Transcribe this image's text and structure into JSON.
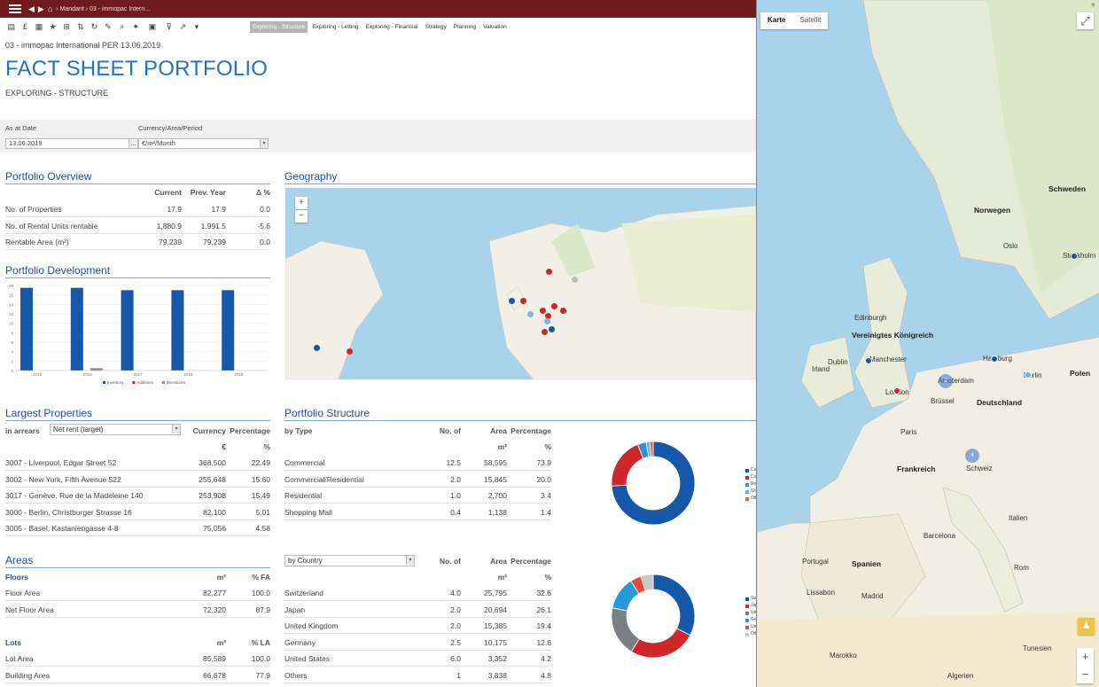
{
  "topbar": {
    "breadcrumb": "› Mandant › 03 - immopac Intern..."
  },
  "toolbar": {
    "tabs": [
      "Exploring - Structure",
      "Exploring - Letting",
      "Exploring - Financial",
      "Strategy",
      "Planning",
      "Valuation"
    ],
    "active_tab": "Exploring - Structure"
  },
  "header": {
    "subtitle": "03 - immopac International PER 13.06.2019",
    "title": "FACT SHEET PORTFOLIO",
    "section": "EXPLORING - STRUCTURE"
  },
  "params": {
    "as_at_label": "As at Date",
    "as_at_value": "13.06.2019",
    "currency_label": "Currency/Area/Period",
    "currency_value": "€/m²/Month",
    "date_button": "..."
  },
  "overview": {
    "title": "Portfolio Overview",
    "headers": [
      "Current",
      "Prev. Year",
      "Δ %"
    ],
    "rows": [
      {
        "label": "No. of Properties",
        "current": "17.9",
        "prev": "17.9",
        "delta": "0.0"
      },
      {
        "label": "No. of Rental Units rentable",
        "current": "1,880.9",
        "prev": "1,991.5",
        "delta": "-5.6"
      },
      {
        "label": "Rentable Area (m²)",
        "current": "79,239",
        "prev": "79,239",
        "delta": "0.0"
      }
    ]
  },
  "development": {
    "title": "Portfolio Development"
  },
  "geography": {
    "title": "Geography",
    "zoom_in": "+",
    "zoom_out": "−"
  },
  "largest": {
    "title": "Largest Properties",
    "in_arrears": "in arrears",
    "dropdown": "Net rent (target)",
    "col_currency": "Currency",
    "col_percentage": "Percentage",
    "unit_currency": "€",
    "unit_pct": "%",
    "rows": [
      {
        "name": "3007 - Liverpool, Edgar Street 52",
        "value": "368,500",
        "pct": "22.49"
      },
      {
        "name": "3002 - New York, Fifth Avenue 522",
        "value": "255,648",
        "pct": "15.60"
      },
      {
        "name": "3017 - Genève, Rue de la Madeleine 140",
        "value": "253,908",
        "pct": "15.49"
      },
      {
        "name": "3000 - Berlin, Christburger Strasse 16",
        "value": "82,100",
        "pct": "5.01"
      },
      {
        "name": "3005 - Basel, Kastaniengasse 4-8",
        "value": "75,056",
        "pct": "4.58"
      }
    ]
  },
  "structure": {
    "title": "Portfolio Structure",
    "by_type": "by Type",
    "col_no": "No. of",
    "col_area": "Area",
    "col_pct": "Percentage",
    "unit_area": "m²",
    "unit_pct": "%",
    "type_rows": [
      {
        "name": "Commercial",
        "no": "12.5",
        "area": "58,595",
        "pct": "73.9"
      },
      {
        "name": "Commercial/Residential",
        "no": "2.0",
        "area": "15,845",
        "pct": "20.0"
      },
      {
        "name": "Residential",
        "no": "1.0",
        "area": "2,700",
        "pct": "3.4"
      },
      {
        "name": "Shopping Mall",
        "no": "0.4",
        "area": "1,138",
        "pct": "1.4"
      }
    ],
    "by_country": "by Country",
    "country_rows": [
      {
        "name": "Switzerland",
        "no": "4.0",
        "area": "25,795",
        "pct": "32.6"
      },
      {
        "name": "Japan",
        "no": "2.0",
        "area": "20,694",
        "pct": "26.1"
      },
      {
        "name": "United Kingdom",
        "no": "2.0",
        "area": "15,385",
        "pct": "19.4"
      },
      {
        "name": "Germany",
        "no": "2.5",
        "area": "10,175",
        "pct": "12.8"
      },
      {
        "name": "United States",
        "no": "6.0",
        "area": "3,352",
        "pct": "4.2"
      },
      {
        "name": "Others",
        "no": "1",
        "area": "3,838",
        "pct": "4.8"
      }
    ]
  },
  "areas": {
    "title": "Areas",
    "floors": "Floors",
    "floors_unit": "m²",
    "floors_pct": "% FA",
    "floor_rows": [
      {
        "name": "Floor Area",
        "value": "82,277",
        "pct": "100.0"
      },
      {
        "name": "Net Floor Area",
        "value": "72,320",
        "pct": "87.9"
      }
    ],
    "lots": "Lots",
    "lots_unit": "m²",
    "lots_pct": "% LA",
    "lot_rows": [
      {
        "name": "Lot Area",
        "value": "85,589",
        "pct": "100.0"
      },
      {
        "name": "Building Area",
        "value": "66,678",
        "pct": "77.9"
      }
    ]
  },
  "bigmap": {
    "tab_map": "Karte",
    "tab_sat": "Satellit",
    "labels": [
      {
        "text": "Schweden",
        "big": true
      },
      {
        "text": "Norwegen",
        "big": true
      },
      {
        "text": "Vereinigtes Königreich",
        "big": true
      },
      {
        "text": "Irland",
        "big": false
      },
      {
        "text": "Deutschland",
        "big": true
      },
      {
        "text": "Polen",
        "big": true
      },
      {
        "text": "Frankreich",
        "big": true
      },
      {
        "text": "Italien",
        "big": false
      },
      {
        "text": "Spanien",
        "big": true
      },
      {
        "text": "Portugal",
        "big": false
      },
      {
        "text": "Marokko",
        "big": false
      },
      {
        "text": "Algerien",
        "big": false
      },
      {
        "text": "Tunesien",
        "big": false
      },
      {
        "text": "Edinburgh",
        "big": false
      },
      {
        "text": "Manchester",
        "big": false
      },
      {
        "text": "London",
        "big": false
      },
      {
        "text": "Dublin",
        "big": false
      },
      {
        "text": "Hamburg",
        "big": false
      },
      {
        "text": "Berlin",
        "big": false
      },
      {
        "text": "Stockholm",
        "big": false
      },
      {
        "text": "Oslo",
        "big": false
      },
      {
        "text": "Paris",
        "big": false
      },
      {
        "text": "Madrid",
        "big": false
      },
      {
        "text": "Lissabon",
        "big": false
      },
      {
        "text": "Barcelona",
        "big": false
      },
      {
        "text": "Rom",
        "big": false
      },
      {
        "text": "Schweiz",
        "big": false
      },
      {
        "text": "Amsterdam",
        "big": false
      },
      {
        "text": "Brüssel",
        "big": false
      }
    ],
    "cluster_labels": [
      "2",
      "4"
    ]
  },
  "charts": {
    "development": {
      "type": "bar",
      "categories": [
        "2015",
        "2016",
        "2017",
        "2018",
        "2019"
      ],
      "series": [
        {
          "name": "Inventory",
          "values": [
            17.5,
            17.5,
            17,
            17,
            17
          ]
        },
        {
          "name": "Additions",
          "values": [
            0,
            0,
            0,
            0,
            0
          ]
        },
        {
          "name": "Divestures",
          "values": [
            0,
            0.5,
            0,
            0,
            0
          ]
        }
      ],
      "y_ticks": [
        "0",
        "2",
        "4",
        "6",
        "8",
        "10",
        "12",
        "14",
        "16",
        "18"
      ],
      "ylim": [
        0,
        18
      ]
    },
    "type_donut": {
      "type": "pie",
      "categories": [
        "Commercial",
        "Commercial/Residential",
        "Residential",
        "Shopping Mall",
        "Others"
      ],
      "values": [
        73.9,
        20.0,
        3.4,
        1.4,
        1.3
      ],
      "colors": [
        "#1558a9",
        "#d0262a",
        "#3c8ed1",
        "#55b8e6",
        "#e86b3a"
      ]
    },
    "country_donut": {
      "type": "pie",
      "categories": [
        "Switzerland",
        "Japan",
        "United Kingdom",
        "Germany",
        "United States",
        "Others"
      ],
      "values": [
        32.6,
        26.1,
        19.4,
        12.8,
        4.2,
        4.8
      ],
      "colors": [
        "#1558a9",
        "#d0262a",
        "#7b7f84",
        "#2499db",
        "#e24a33",
        "#c8c8c8"
      ]
    }
  }
}
